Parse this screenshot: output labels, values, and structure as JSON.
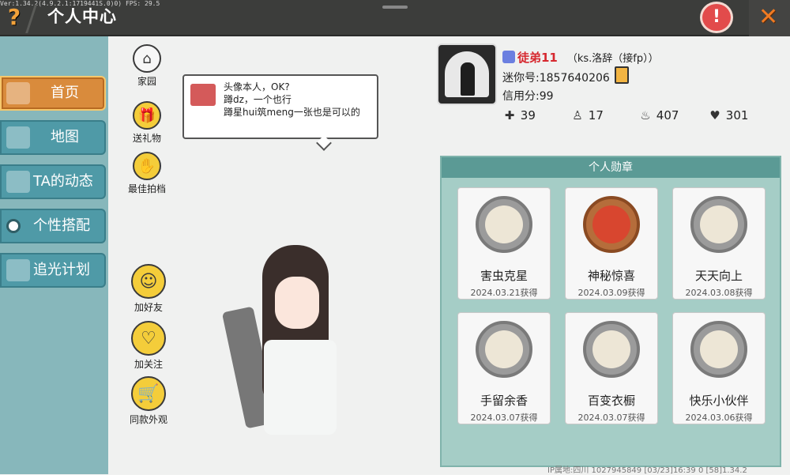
{
  "topbar": {
    "version": "Ver:1.34.2(4.9.2.1:1719441S.0)0) FPS: 29.5",
    "title": "个人中心",
    "help_label": "?",
    "warn_label": "!",
    "close_label": "✕"
  },
  "nav": {
    "items": [
      {
        "label": "首页"
      },
      {
        "label": "地图"
      },
      {
        "label": "TA的动态"
      },
      {
        "label": "个性搭配"
      },
      {
        "label": "追光计划"
      }
    ]
  },
  "actions": {
    "home": "家园",
    "gift": "送礼物",
    "partner": "最佳拍档",
    "add_friend": "加好友",
    "follow": "加关注",
    "same_look": "同款外观"
  },
  "bubble": {
    "line1": "头像本人，OK?",
    "line2": "蹲dz，一个也行",
    "line3": "蹲星hui筑meng一张也是可以的"
  },
  "profile": {
    "nickname": "徒弟11",
    "tag": "（ks.洛辞（接fp））",
    "mini_id": "迷你号:1857640206",
    "credit": "信用分:99",
    "stats": {
      "plus": "39",
      "friends": "17",
      "hot": "407",
      "likes": "301"
    }
  },
  "medals": {
    "title": "个人勋章",
    "items": [
      {
        "name": "害虫克星",
        "date": "2024.03.21获得"
      },
      {
        "name": "神秘惊喜",
        "date": "2024.03.09获得"
      },
      {
        "name": "天天向上",
        "date": "2024.03.08获得"
      },
      {
        "name": "手留余香",
        "date": "2024.03.07获得"
      },
      {
        "name": "百变衣橱",
        "date": "2024.03.07获得"
      },
      {
        "name": "快乐小伙伴",
        "date": "2024.03.06获得"
      }
    ]
  },
  "footer": "IP属地:四川    1027945849   [03/23]16:39 0   [58]1.34.2"
}
